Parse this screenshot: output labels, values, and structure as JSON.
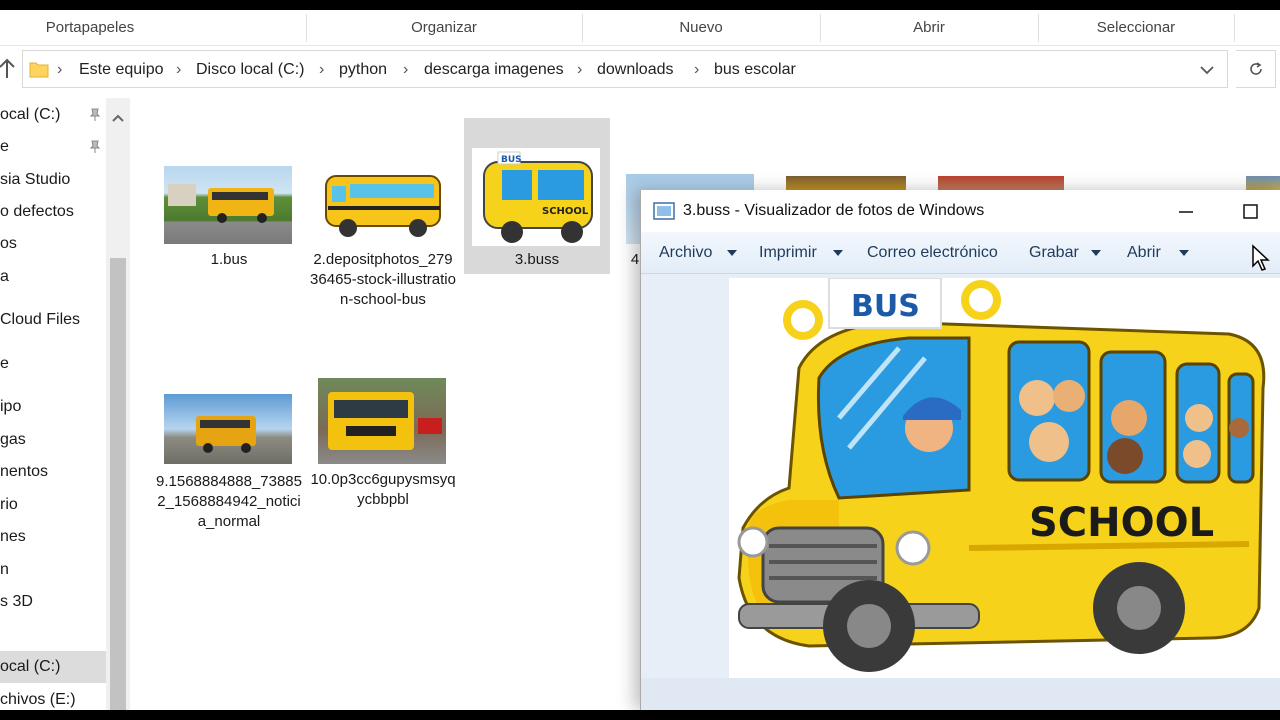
{
  "ribbon": {
    "groups": [
      "Portapapeles",
      "Organizar",
      "Nuevo",
      "Abrir",
      "Seleccionar"
    ]
  },
  "address": {
    "crumbs": [
      "Este equipo",
      "Disco local (C:)",
      "python",
      "descarga imagenes",
      "downloads",
      "bus escolar"
    ]
  },
  "nav": {
    "items": [
      "ocal (C:)",
      "e",
      "sia Studio",
      "o defectos",
      "os",
      "a",
      "Cloud Files",
      "e",
      "ipo",
      "gas",
      "nentos",
      "rio",
      "nes",
      "n",
      "s 3D",
      "ocal (C:)",
      "chivos (E:)"
    ]
  },
  "files": [
    {
      "name": "1.bus"
    },
    {
      "name": "2.depositphotos_27936465-stock-illustration-school-bus"
    },
    {
      "name": "3.buss"
    },
    {
      "name": "4"
    },
    {
      "name": "9.1568884888_738852_1568884942_noticia_normal"
    },
    {
      "name": "10.0p3cc6gupysmsyqycbbpbl"
    }
  ],
  "viewer": {
    "title": "3.buss - Visualizador de fotos de Windows",
    "menu": [
      "Archivo",
      "Imprimir",
      "Correo electrónico",
      "Grabar",
      "Abrir"
    ],
    "image": {
      "sign": "BUS",
      "side_text": "SCHOOL"
    }
  },
  "colors": {
    "bus_yellow": "#f7d21a",
    "window_blue": "#2a9be0",
    "selection": "#d9d9d9",
    "viewer_menu_text": "#1f3b5c"
  }
}
